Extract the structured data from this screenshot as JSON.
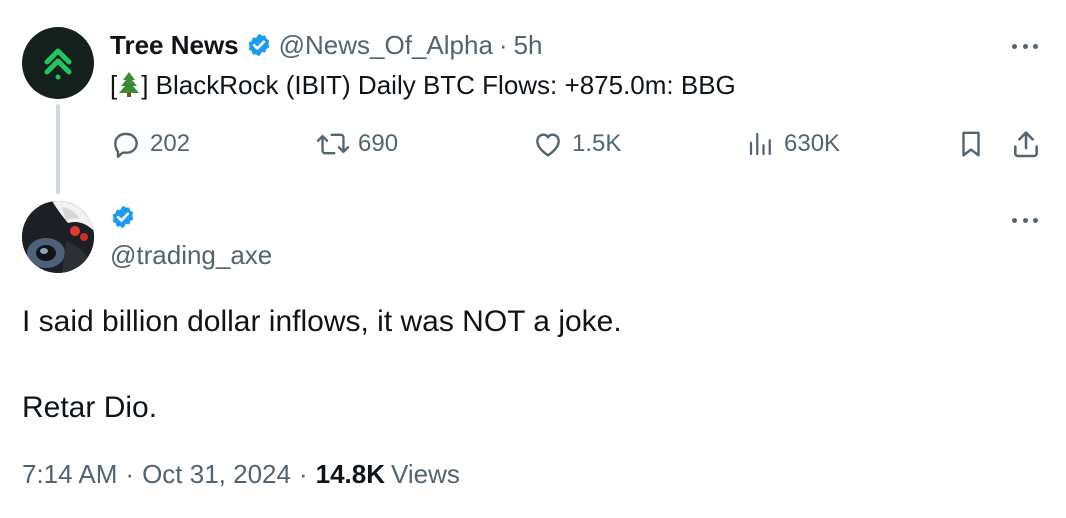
{
  "parent_tweet": {
    "author_name": "Tree News",
    "handle": "@News_Of_Alpha",
    "separator": "·",
    "time_ago": "5h",
    "text_prefix": "[",
    "text_emoji": "tree-emoji",
    "text_suffix": "] BlackRock (IBIT) Daily BTC Flows: +875.0m: BBG",
    "stats": {
      "replies": "202",
      "reposts": "690",
      "likes": "1.5K",
      "views": "630K"
    },
    "icons": [
      "arrow-up-logo",
      "verified-badge-icon",
      "more-icon",
      "reply-icon",
      "repost-icon",
      "like-icon",
      "views-icon",
      "bookmark-icon",
      "share-icon"
    ]
  },
  "reply_tweet": {
    "handle": "@trading_axe",
    "body": [
      "I said billion dollar inflows, it was NOT a joke.",
      "Retar Dio."
    ],
    "time": "7:14 AM",
    "date": "Oct 31, 2024",
    "separator": "·",
    "views_count": "14.8K",
    "views_label": "Views"
  },
  "colors": {
    "accent_blue": "#1d9bf0",
    "muted_text": "#536471",
    "main_text": "#0f1419",
    "logo_green": "#22c55e",
    "logo_bg": "#14201c"
  }
}
